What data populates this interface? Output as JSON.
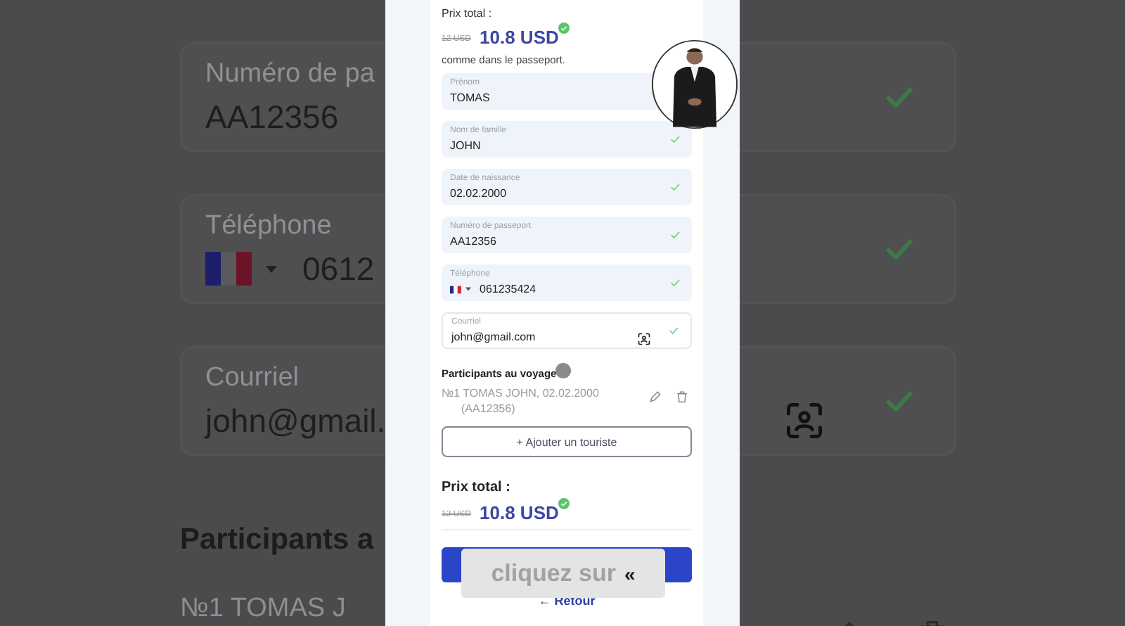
{
  "background": {
    "cards": [
      {
        "kind": "text",
        "label": "Numéro de pa",
        "value": "AA12356",
        "valid": true
      },
      {
        "kind": "phone",
        "label": "Téléphone",
        "value": "0612",
        "valid": true
      },
      {
        "kind": "email",
        "label": "Courriel",
        "value": "john@gmail.",
        "valid": true
      }
    ],
    "heading": "Participants a",
    "participant": "№1 TOMAS J"
  },
  "phone": {
    "top_price": {
      "label": "Prix total :",
      "old": "12 USD",
      "current": "10.8 USD"
    },
    "note": "comme dans le passeport.",
    "fields": [
      {
        "kind": "text",
        "label": "Prénom",
        "value": "TOMAS",
        "valid": false
      },
      {
        "kind": "text",
        "label": "Nom de famille",
        "value": "JOHN",
        "valid": true
      },
      {
        "kind": "text",
        "label": "Date de naissance",
        "value": "02.02.2000",
        "valid": true
      },
      {
        "kind": "text",
        "label": "Numéro de passeport",
        "value": "AA12356",
        "valid": true
      },
      {
        "kind": "phone",
        "label": "Téléphone",
        "value": "061235424",
        "valid": true
      },
      {
        "kind": "email",
        "label": "Courriel",
        "value": "john@gmail.com",
        "valid": true
      }
    ],
    "participants": {
      "title": "Participants au voyage",
      "items": [
        {
          "line1": "№1 TOMAS JOHN, 02.02.2000",
          "line2": "(AA12356)"
        }
      ]
    },
    "add_button": "+ Ajouter un touriste",
    "total": {
      "label": "Prix total :",
      "old": "12 USD",
      "current": "10.8 USD"
    },
    "back_link": "← Retour"
  },
  "caption": {
    "text": "cliquez sur",
    "mark": "«"
  }
}
